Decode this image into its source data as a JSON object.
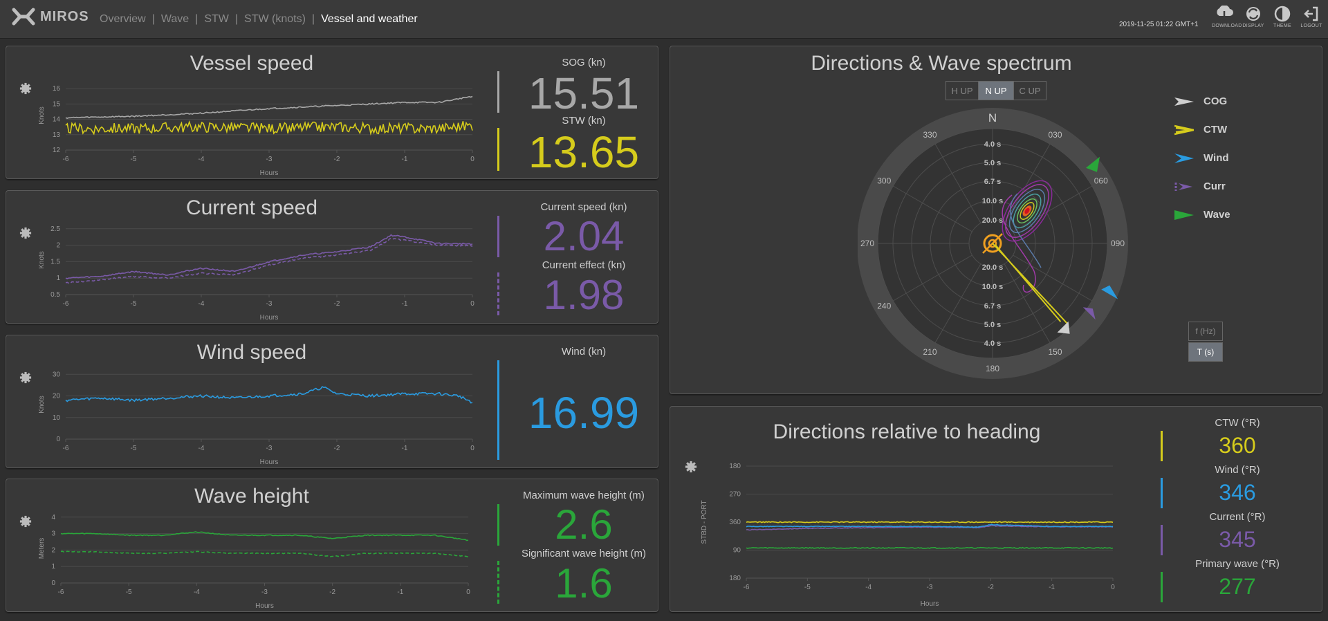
{
  "app": {
    "brand": "MIROS",
    "nav": [
      "Overview",
      "Wave",
      "STW",
      "STW (knots)",
      "Vessel and weather"
    ],
    "nav_active_index": 4,
    "timestamp": "2019-11-25 01:22 GMT+1",
    "toolbar": [
      {
        "label": "DOWNLOAD",
        "icon": "download-icon"
      },
      {
        "label": "DISPLAY",
        "icon": "display-icon"
      },
      {
        "label": "THEME",
        "icon": "theme-icon"
      },
      {
        "label": "LOGOUT",
        "icon": "logout-icon"
      }
    ]
  },
  "colors": {
    "sog": "#a8a8a8",
    "stw": "#d6cc1c",
    "current": "#7a5aa8",
    "wind": "#2a9be0",
    "wave": "#2aa63a",
    "ctw": "#d6cc1c"
  },
  "vessel_speed": {
    "title": "Vessel speed",
    "ylabel": "Knots",
    "xlabel": "Hours",
    "sog_label": "SOG (kn)",
    "sog_value": "15.51",
    "stw_label": "STW (kn)",
    "stw_value": "13.65"
  },
  "current_speed": {
    "title": "Current speed",
    "ylabel": "Knots",
    "xlabel": "Hours",
    "speed_label": "Current speed (kn)",
    "speed_value": "2.04",
    "effect_label": "Current effect (kn)",
    "effect_value": "1.98"
  },
  "wind_speed": {
    "title": "Wind speed",
    "ylabel": "Knots",
    "xlabel": "Hours",
    "wind_label": "Wind (kn)",
    "wind_value": "16.99"
  },
  "wave_height": {
    "title": "Wave height",
    "ylabel": "Meters",
    "xlabel": "Hours",
    "max_label": "Maximum wave height (m)",
    "max_value": "2.6",
    "sig_label": "Significant wave height (m)",
    "sig_value": "1.6"
  },
  "directions": {
    "title": "Directions & Wave spectrum",
    "orientation_buttons": [
      "H UP",
      "N UP",
      "C UP"
    ],
    "orientation_active": 1,
    "north_label": "N",
    "bearing_labels": [
      "030",
      "060",
      "090",
      "150",
      "180",
      "210",
      "240",
      "270",
      "300",
      "330"
    ],
    "period_labels": [
      "4.0 s",
      "5.0 s",
      "6.7 s",
      "10.0 s",
      "20.0 s"
    ],
    "legend": [
      {
        "label": "COG",
        "icon": "cog-arrow-icon",
        "color": "#cfcfcf"
      },
      {
        "label": "CTW",
        "icon": "ctw-arrow-icon",
        "color": "#d6cc1c"
      },
      {
        "label": "Wind",
        "icon": "wind-arrow-icon",
        "color": "#2a9be0"
      },
      {
        "label": "Curr",
        "icon": "current-arrow-icon",
        "color": "#7a5aa8"
      },
      {
        "label": "Wave",
        "icon": "wave-arrow-icon",
        "color": "#2aa63a"
      }
    ],
    "unit_buttons": [
      "f (Hz)",
      "T (s)"
    ],
    "unit_active": 1
  },
  "relative": {
    "title": "Directions relative to heading",
    "ylabel": "STBD  -  PORT",
    "xlabel": "Hours",
    "ctw_label": "CTW (°R)",
    "ctw_value": "360",
    "wind_label": "Wind (°R)",
    "wind_value": "346",
    "current_label": "Current (°R)",
    "current_value": "345",
    "wave_label": "Primary wave (°R)",
    "wave_value": "277"
  },
  "chart_data": [
    {
      "type": "line",
      "title": "Vessel speed",
      "xlabel": "Hours",
      "ylabel": "Knots",
      "x_ticks": [
        -6,
        -5,
        -4,
        -3,
        -2,
        -1,
        0
      ],
      "y_ticks": [
        12,
        13,
        14,
        15,
        16
      ],
      "xlim": [
        -6,
        0
      ],
      "ylim": [
        12,
        16.5
      ],
      "x": [
        -6,
        -5,
        -4,
        -3,
        -2,
        -1.5,
        -1,
        -0.5,
        0
      ],
      "series": [
        {
          "name": "SOG",
          "values": [
            14.1,
            14.2,
            14.4,
            14.7,
            14.9,
            15.0,
            15.1,
            15.1,
            15.5
          ]
        },
        {
          "name": "STW",
          "values": [
            13.4,
            13.4,
            13.5,
            13.4,
            13.5,
            13.4,
            13.4,
            13.4,
            13.6
          ]
        }
      ]
    },
    {
      "type": "line",
      "title": "Current speed",
      "xlabel": "Hours",
      "ylabel": "Knots",
      "x_ticks": [
        -6,
        -5,
        -4,
        -3,
        -2,
        -1,
        0
      ],
      "y_ticks": [
        0.5,
        1,
        1.5,
        2,
        2.5
      ],
      "xlim": [
        -6,
        0
      ],
      "ylim": [
        0.5,
        2.6
      ],
      "x": [
        -6,
        -5.5,
        -5,
        -4.5,
        -4,
        -3.5,
        -3,
        -2.5,
        -2,
        -1.5,
        -1.2,
        -1,
        -0.5,
        0
      ],
      "series": [
        {
          "name": "Current speed",
          "values": [
            1.0,
            1.05,
            1.2,
            1.1,
            1.3,
            1.2,
            1.5,
            1.7,
            1.8,
            1.95,
            2.3,
            2.25,
            2.05,
            2.04
          ]
        },
        {
          "name": "Current effect",
          "values": [
            0.85,
            0.95,
            1.05,
            1.0,
            1.15,
            1.1,
            1.4,
            1.6,
            1.7,
            1.85,
            2.2,
            2.15,
            2.0,
            1.98
          ]
        }
      ]
    },
    {
      "type": "line",
      "title": "Wind speed",
      "xlabel": "Hours",
      "ylabel": "Knots",
      "x_ticks": [
        -6,
        -5,
        -4,
        -3,
        -2,
        -1,
        0
      ],
      "y_ticks": [
        0,
        10,
        20,
        30
      ],
      "xlim": [
        -6,
        0
      ],
      "ylim": [
        0,
        32
      ],
      "x": [
        -6,
        -5.5,
        -5,
        -4.5,
        -4,
        -3.5,
        -3,
        -2.5,
        -2.2,
        -2,
        -1.5,
        -1,
        -0.5,
        -0.2,
        0
      ],
      "series": [
        {
          "name": "Wind",
          "values": [
            18,
            19,
            18,
            19,
            20,
            19,
            20,
            21,
            24,
            21,
            20,
            21,
            21,
            20,
            17
          ]
        }
      ]
    },
    {
      "type": "line",
      "title": "Wave height",
      "xlabel": "Hours",
      "ylabel": "Meters",
      "x_ticks": [
        -6,
        -5,
        -4,
        -3,
        -2,
        -1,
        0
      ],
      "y_ticks": [
        0,
        1,
        2,
        3,
        4
      ],
      "xlim": [
        -6,
        0
      ],
      "ylim": [
        0,
        4.2
      ],
      "x": [
        -6,
        -5.5,
        -5,
        -4.5,
        -4,
        -3.5,
        -3,
        -2.5,
        -2,
        -1.5,
        -1,
        -0.5,
        0
      ],
      "series": [
        {
          "name": "Maximum wave height",
          "values": [
            3.0,
            3.0,
            2.9,
            2.9,
            3.1,
            2.9,
            2.9,
            2.9,
            2.7,
            2.9,
            2.9,
            2.9,
            2.6
          ]
        },
        {
          "name": "Significant wave height",
          "values": [
            1.9,
            1.9,
            1.8,
            1.8,
            1.9,
            1.8,
            1.8,
            1.8,
            1.6,
            1.8,
            1.8,
            1.8,
            1.6
          ]
        }
      ]
    },
    {
      "type": "line",
      "title": "Directions relative to heading",
      "xlabel": "Hours",
      "ylabel": "STBD  -  PORT",
      "x_ticks": [
        -6,
        -5,
        -4,
        -3,
        -2,
        -1,
        0
      ],
      "y_tick_labels": [
        "180",
        "270",
        "360",
        "90",
        "180"
      ],
      "xlim": [
        -6,
        0
      ],
      "ylim": [
        -180,
        180
      ],
      "x": [
        -6,
        -5,
        -4,
        -3,
        -2.2,
        -2,
        -1,
        0
      ],
      "series": [
        {
          "name": "Primary wave",
          "values": [
            -83,
            -83,
            -83,
            -83,
            -83,
            -83,
            -83,
            -83
          ]
        },
        {
          "name": "Current",
          "values": [
            -25,
            -20,
            -18,
            -16,
            -18,
            -12,
            -15,
            -15
          ]
        },
        {
          "name": "Wind",
          "values": [
            -14,
            -14,
            -14,
            -14,
            -16,
            -8,
            -14,
            -14
          ]
        },
        {
          "name": "CTW",
          "values": [
            0,
            0,
            0,
            0,
            0,
            0,
            0,
            0
          ]
        }
      ]
    }
  ]
}
